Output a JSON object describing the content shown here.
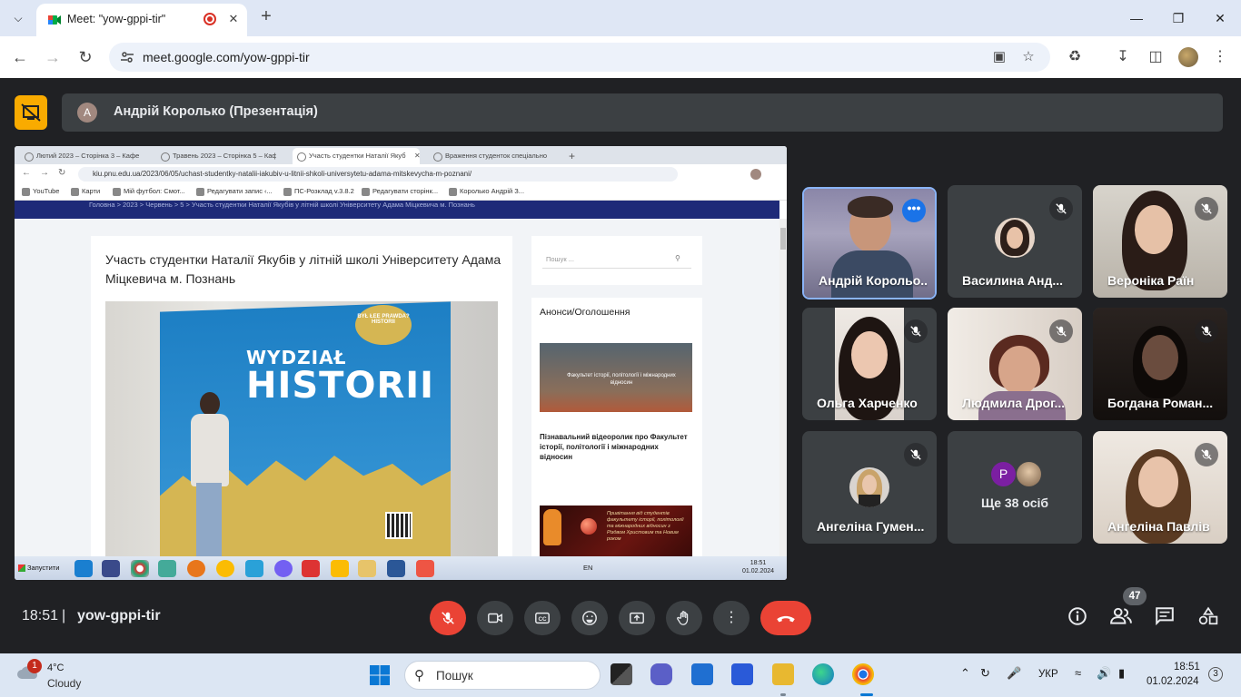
{
  "browser": {
    "tab_title": "Meet: \"yow-gppi-tir\"",
    "url": "meet.google.com/yow-gppi-tir",
    "accent": "#dfe7f5"
  },
  "meet": {
    "presenter": {
      "initial": "A",
      "label": "Андрій Королько (Презентація)"
    },
    "shared": {
      "tabs": [
        {
          "label": "Лютий 2023 – Сторінка 3 – Кафе"
        },
        {
          "label": "Травень 2023 – Сторінка 5 – Каф"
        },
        {
          "label": "Участь студентки Наталії Якуб"
        },
        {
          "label": "Враження студенток спеціально"
        }
      ],
      "url": "kiu.pnu.edu.ua/2023/06/05/uchast-studentky-natalii-iakubiv-u-litnii-shkoli-universytetu-adama-mitskevycha-m-poznani/",
      "bookmarks": [
        "YouTube",
        "Карти",
        "Мій футбол: Смот...",
        "Редагувати запис ‹...",
        "ПС-Розклад v.3.8.2",
        "Редагувати сторінк...",
        "Королько Андрій З..."
      ],
      "breadcrumb": "Головна  >  2023  >  Червень  >  5  >  Участь студентки Наталії Якубів у літній школі Університету Адама Міцкевича м. Познань",
      "article_title": "Участь студентки Наталії Якубів у літній школі Університету Адама Міцкевича м. Познань",
      "photo_text1": "WYDZIAŁ",
      "photo_text2": "HISTORII",
      "bubble_text": "BYŁ ŁEE PRAWDA? HISTORII",
      "search_placeholder": "Пошук ...",
      "announce_title": "Анонси/Оголошення",
      "announce_img_text": "Факультет історії, політології і міжнародних відносин",
      "announce_caption": "Пізнавальний відеоролик про Факультет історії, політології і міжнародних відносин",
      "announce_img2_text": "Привітання від студентів факультету історії, політології та міжнародних відносин з Різдвом Христовим та Новим роком",
      "taskbar_start": "Запустити",
      "lang": "EN",
      "clock_time": "18:51",
      "clock_date": "01.02.2024"
    },
    "participants": [
      {
        "name": "Андрій Корольо...",
        "speaking": true,
        "muted": false
      },
      {
        "name": "Василина Анд...",
        "muted": true
      },
      {
        "name": "Вероніка Раїн",
        "muted": true
      },
      {
        "name": "Ольга Харченко",
        "muted": true
      },
      {
        "name": "Людмила Дрог...",
        "muted": true
      },
      {
        "name": "Богдана Роман...",
        "muted": true
      },
      {
        "name": "Ангеліна Гумен...",
        "muted": true
      },
      {
        "name": "Ще 38 осіб",
        "initial": "P"
      },
      {
        "name": "Ангеліна Павлів",
        "muted": true
      }
    ],
    "time": "18:51",
    "separator": "|",
    "meeting_code": "yow-gppi-tir",
    "people_count": "47"
  },
  "taskbar": {
    "weather_temp": "4°C",
    "weather_desc": "Cloudy",
    "weather_badge": "1",
    "search_placeholder": "Пошук",
    "lang": "УКР",
    "time": "18:51",
    "date": "01.02.2024",
    "notifications": "3"
  }
}
